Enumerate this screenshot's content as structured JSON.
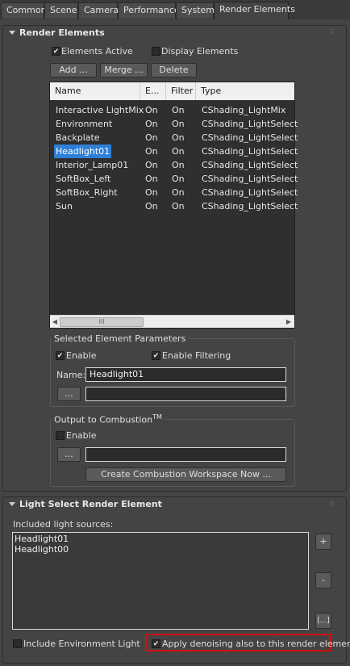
{
  "tabs": [
    {
      "label": "Common"
    },
    {
      "label": "Scene"
    },
    {
      "label": "Camera"
    },
    {
      "label": "Performance"
    },
    {
      "label": "System"
    },
    {
      "label": "Render Elements"
    }
  ],
  "active_tab": "Render Elements",
  "render_elements": {
    "title": "Render Elements",
    "elements_active_label": "Elements Active",
    "elements_active_checked": true,
    "display_elements_label": "Display Elements",
    "display_elements_checked": false,
    "add_label": "Add ...",
    "merge_label": "Merge ...",
    "delete_label": "Delete",
    "columns": [
      "Name",
      "E...",
      "Filter",
      "Type"
    ],
    "rows": [
      {
        "name": "Interactive LightMix",
        "enabled": "On",
        "filter": "On",
        "type": "CShading_LightMix"
      },
      {
        "name": "Environment",
        "enabled": "On",
        "filter": "On",
        "type": "CShading_LightSelect"
      },
      {
        "name": "Backplate",
        "enabled": "On",
        "filter": "On",
        "type": "CShading_LightSelect"
      },
      {
        "name": "Headlight01",
        "enabled": "On",
        "filter": "On",
        "type": "CShading_LightSelect"
      },
      {
        "name": "Interior_Lamp01",
        "enabled": "On",
        "filter": "On",
        "type": "CShading_LightSelect"
      },
      {
        "name": "SoftBox_Left",
        "enabled": "On",
        "filter": "On",
        "type": "CShading_LightSelect"
      },
      {
        "name": "SoftBox_Right",
        "enabled": "On",
        "filter": "On",
        "type": "CShading_LightSelect"
      },
      {
        "name": "Sun",
        "enabled": "On",
        "filter": "On",
        "type": "CShading_LightSelect"
      }
    ],
    "selected_row": "Headlight01",
    "scroll_grip": "III",
    "scroll_left_arrow": "◀",
    "scroll_right_arrow": "▶"
  },
  "selected_params": {
    "title": "Selected Element Parameters",
    "enable_label": "Enable",
    "enable_checked": true,
    "enable_filtering_label": "Enable Filtering",
    "enable_filtering_checked": true,
    "name_label": "Name:",
    "name_value": "Headlight01",
    "browse_label": "...",
    "path_value": ""
  },
  "combustion": {
    "title": "Output to Combustion",
    "title_sup": "TM",
    "enable_label": "Enable",
    "enable_checked": false,
    "browse_label": "...",
    "path_value": "",
    "create_label": "Create Combustion Workspace Now ..."
  },
  "light_select": {
    "title": "Light Select Render Element",
    "included_label": "Included light sources:",
    "sources": [
      "Headlight01",
      "Headlight00"
    ],
    "add_label": "+",
    "remove_label": "-",
    "browse_label": "[...]",
    "include_env_label": "Include Environment Light",
    "include_env_checked": false,
    "denoise_label": "Apply denoising also to this render element",
    "denoise_checked": true,
    "highlight_color": "#d01010"
  },
  "colors": {
    "panel_bg": "#444444",
    "list_bg": "#2f2f2f",
    "selection": "#2f7fd6"
  }
}
